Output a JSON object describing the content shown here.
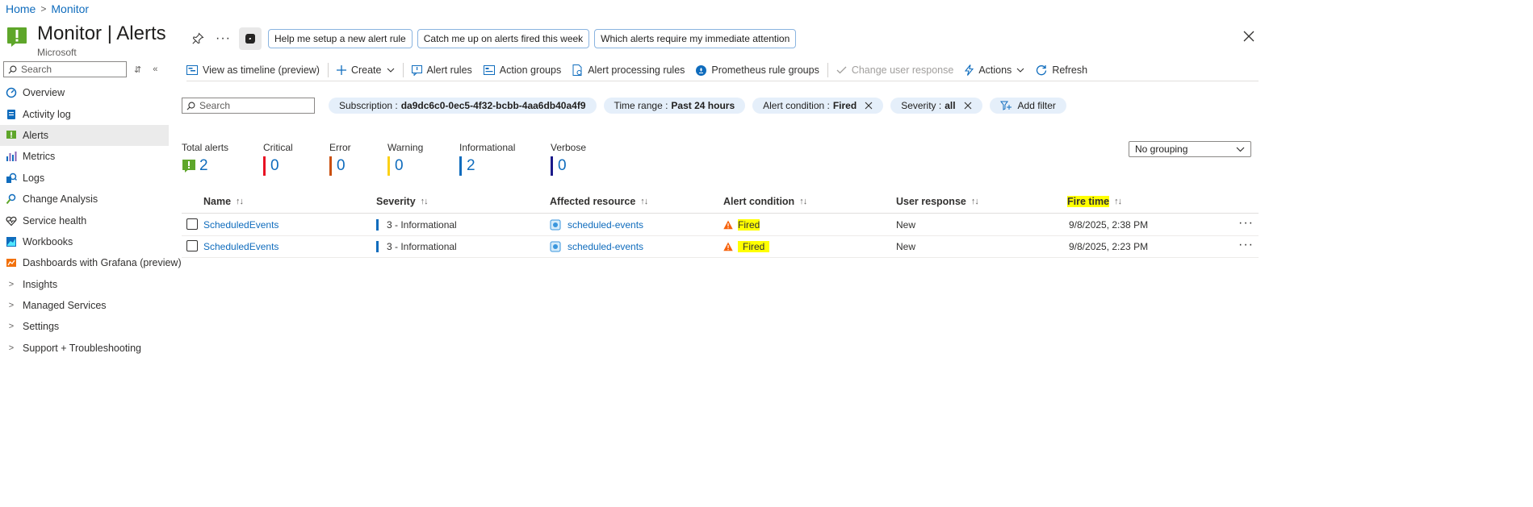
{
  "breadcrumb": {
    "home": "Home",
    "monitor": "Monitor"
  },
  "header": {
    "title": "Monitor | Alerts",
    "subtitle": "Microsoft",
    "more": "···",
    "prompts": [
      "Help me setup a new alert rule",
      "Catch me up on alerts fired this week",
      "Which alerts require my immediate attention"
    ]
  },
  "sidebar": {
    "search_placeholder": "Search",
    "items": [
      {
        "label": "Overview",
        "icon": "overview-icon"
      },
      {
        "label": "Activity log",
        "icon": "activity-log-icon"
      },
      {
        "label": "Alerts",
        "icon": "alerts-icon",
        "active": true
      },
      {
        "label": "Metrics",
        "icon": "metrics-icon"
      },
      {
        "label": "Logs",
        "icon": "logs-icon"
      },
      {
        "label": "Change Analysis",
        "icon": "change-analysis-icon"
      },
      {
        "label": "Service health",
        "icon": "service-health-icon"
      },
      {
        "label": "Workbooks",
        "icon": "workbooks-icon"
      },
      {
        "label": "Dashboards with Grafana (preview)",
        "icon": "grafana-icon"
      },
      {
        "label": "Insights",
        "expandable": true
      },
      {
        "label": "Managed Services",
        "expandable": true
      },
      {
        "label": "Settings",
        "expandable": true
      },
      {
        "label": "Support + Troubleshooting",
        "expandable": true
      }
    ]
  },
  "toolbar": {
    "view_timeline": "View as timeline (preview)",
    "create": "Create",
    "alert_rules": "Alert rules",
    "action_groups": "Action groups",
    "alert_processing_rules": "Alert processing rules",
    "prometheus_rule_groups": "Prometheus rule groups",
    "change_user_response": "Change user response",
    "actions": "Actions",
    "refresh": "Refresh"
  },
  "filters": {
    "search_placeholder": "Search",
    "subscription_label": "Subscription : ",
    "subscription_value": "da9dc6c0-0ec5-4f32-bcbb-4aa6db40a4f9",
    "time_range_label": "Time range : ",
    "time_range_value": "Past 24 hours",
    "alert_condition_label": "Alert condition : ",
    "alert_condition_value": "Fired",
    "severity_label": "Severity : ",
    "severity_value": "all",
    "add_filter": "Add filter"
  },
  "summary": {
    "total_label": "Total alerts",
    "total": "2",
    "critical_label": "Critical",
    "critical": "0",
    "error_label": "Error",
    "error": "0",
    "warning_label": "Warning",
    "warning": "0",
    "informational_label": "Informational",
    "informational": "2",
    "verbose_label": "Verbose",
    "verbose": "0",
    "colors": {
      "critical": "#e81123",
      "error": "#ca5010",
      "warning": "#fcd116",
      "informational": "#0f6cbd",
      "verbose": "#1b1a8a"
    }
  },
  "grouping": {
    "value": "No grouping"
  },
  "table": {
    "columns": {
      "name": "Name",
      "severity": "Severity",
      "resource": "Affected resource",
      "condition": "Alert condition",
      "user_response": "User response",
      "fire_time": "Fire time"
    },
    "sort_glyph": "↑↓",
    "rows": [
      {
        "name": "ScheduledEvents",
        "severity": "3 - Informational",
        "resource": "scheduled-events",
        "condition": "Fired",
        "user_response": "New",
        "fire_time": "9/8/2025, 2:38 PM",
        "more": "···"
      },
      {
        "name": "ScheduledEvents",
        "severity": "3 - Informational",
        "resource": "scheduled-events",
        "condition": "Fired",
        "user_response": "New",
        "fire_time": "9/8/2025, 2:23 PM",
        "more": "···"
      }
    ]
  }
}
